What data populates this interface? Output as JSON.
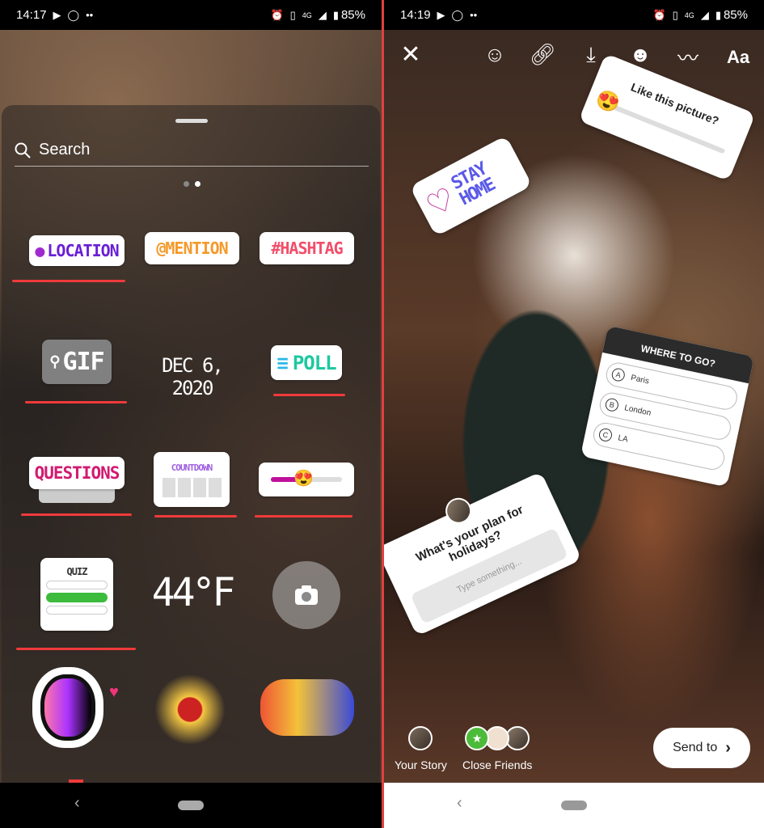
{
  "left": {
    "status": {
      "time": "14:17",
      "network": "4G",
      "battery": "85%"
    },
    "search": {
      "placeholder": "Search",
      "icon": "search-icon"
    },
    "pager": {
      "pages": 2,
      "active": 2
    },
    "stickers": {
      "location": "LOCATION",
      "mention": "@MENTION",
      "hashtag": "#HASHTAG",
      "gif": "GIF",
      "date": "DEC 6, 2020",
      "poll": "POLL",
      "questions": "QUESTIONS",
      "countdown": "COUNTDOWN",
      "slider_emoji": "😍",
      "quiz": "QUIZ",
      "temperature": "44°F"
    },
    "colors": {
      "location": "#7a1fd6",
      "underline": "#f03a3a",
      "poll": "#1ec8a0"
    }
  },
  "right": {
    "status": {
      "time": "14:19",
      "network": "4G",
      "battery": "85%"
    },
    "toolbar": {
      "text_tool": "Aa"
    },
    "slider_sticker": {
      "question": "Like this picture?",
      "emoji": "😍"
    },
    "stay_home": {
      "line1": "STAY",
      "line2": "HOME"
    },
    "poll_sticker": {
      "title": "WHERE TO GO?",
      "options": [
        {
          "letter": "A",
          "label": "Paris"
        },
        {
          "letter": "B",
          "label": "London"
        },
        {
          "letter": "C",
          "label": "LA"
        }
      ]
    },
    "question_sticker": {
      "question": "What's your plan for holidays?",
      "placeholder": "Type something..."
    },
    "bottom": {
      "your_story": "Your Story",
      "close_friends": "Close Friends",
      "send_to": "Send to"
    }
  }
}
